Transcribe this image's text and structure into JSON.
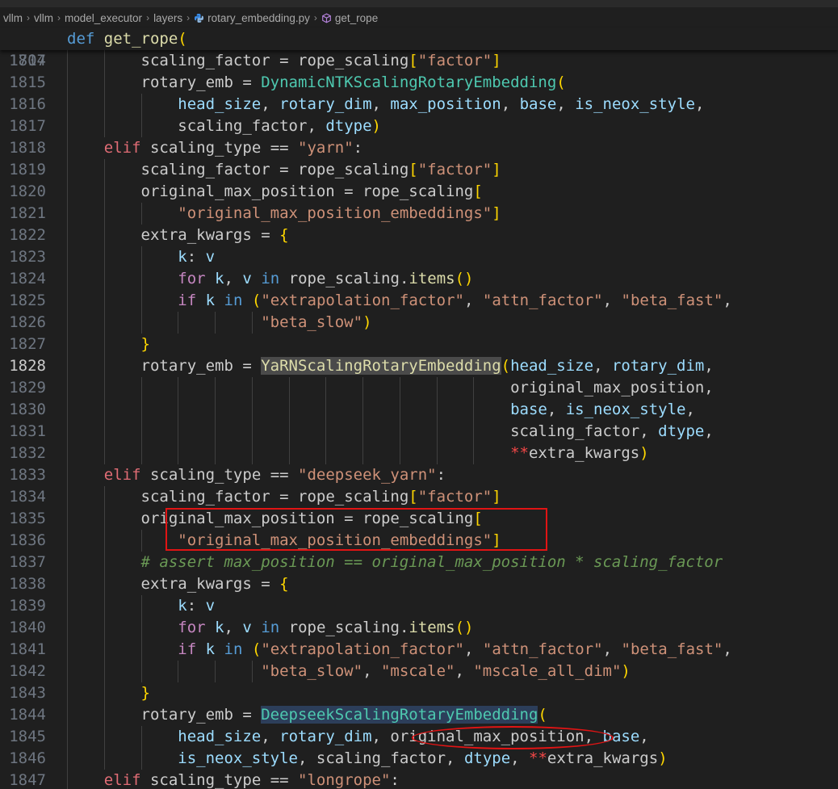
{
  "tab_strip": [
    "",
    ""
  ],
  "breadcrumb": {
    "items": [
      "vllm",
      "vllm",
      "model_executor",
      "layers",
      "rotary_embedding.py",
      "get_rope"
    ]
  },
  "colors": {
    "keyword": "#569cd6",
    "control": "#c586c0",
    "elif": "#e06c75",
    "function": "#dcdcaa",
    "class": "#4ec9b0",
    "string": "#ce9178",
    "variable": "#9cdcfe",
    "bracket1": "#ffd700",
    "bracket2": "#da70d6",
    "operator_red": "#f44747",
    "comment": "#6a9955",
    "annotation": "#e11414"
  },
  "sticky": {
    "num": "1707",
    "text": "def get_rope("
  },
  "active_line": "1828",
  "lines": [
    {
      "num": "1814",
      "text": "        scaling_factor = rope_scaling[\"factor\"]"
    },
    {
      "num": "1815",
      "text": "        rotary_emb = DynamicNTKScalingRotaryEmbedding("
    },
    {
      "num": "1816",
      "text": "            head_size, rotary_dim, max_position, base, is_neox_style,"
    },
    {
      "num": "1817",
      "text": "            scaling_factor, dtype)"
    },
    {
      "num": "1818",
      "text": "    elif scaling_type == \"yarn\":"
    },
    {
      "num": "1819",
      "text": "        scaling_factor = rope_scaling[\"factor\"]"
    },
    {
      "num": "1820",
      "text": "        original_max_position = rope_scaling["
    },
    {
      "num": "1821",
      "text": "            \"original_max_position_embeddings\"]"
    },
    {
      "num": "1822",
      "text": "        extra_kwargs = {"
    },
    {
      "num": "1823",
      "text": "            k: v"
    },
    {
      "num": "1824",
      "text": "            for k, v in rope_scaling.items()"
    },
    {
      "num": "1825",
      "text": "            if k in (\"extrapolation_factor\", \"attn_factor\", \"beta_fast\","
    },
    {
      "num": "1826",
      "text": "                     \"beta_slow\")"
    },
    {
      "num": "1827",
      "text": "        }"
    },
    {
      "num": "1828",
      "text": "        rotary_emb = YaRNScalingRotaryEmbedding(head_size, rotary_dim,"
    },
    {
      "num": "1829",
      "text": "                                                original_max_position,"
    },
    {
      "num": "1830",
      "text": "                                                base, is_neox_style,"
    },
    {
      "num": "1831",
      "text": "                                                scaling_factor, dtype,"
    },
    {
      "num": "1832",
      "text": "                                                **extra_kwargs)"
    },
    {
      "num": "1833",
      "text": "    elif scaling_type == \"deepseek_yarn\":"
    },
    {
      "num": "1834",
      "text": "        scaling_factor = rope_scaling[\"factor\"]"
    },
    {
      "num": "1835",
      "text": "        original_max_position = rope_scaling["
    },
    {
      "num": "1836",
      "text": "            \"original_max_position_embeddings\"]"
    },
    {
      "num": "1837",
      "text": "        # assert max_position == original_max_position * scaling_factor"
    },
    {
      "num": "1838",
      "text": "        extra_kwargs = {"
    },
    {
      "num": "1839",
      "text": "            k: v"
    },
    {
      "num": "1840",
      "text": "            for k, v in rope_scaling.items()"
    },
    {
      "num": "1841",
      "text": "            if k in (\"extrapolation_factor\", \"attn_factor\", \"beta_fast\","
    },
    {
      "num": "1842",
      "text": "                     \"beta_slow\", \"mscale\", \"mscale_all_dim\")"
    },
    {
      "num": "1843",
      "text": "        }"
    },
    {
      "num": "1844",
      "text": "        rotary_emb = DeepseekScalingRotaryEmbedding("
    },
    {
      "num": "1845",
      "text": "            head_size, rotary_dim, original_max_position, base,"
    },
    {
      "num": "1846",
      "text": "            is_neox_style, scaling_factor, dtype, **extra_kwargs)"
    },
    {
      "num": "1847",
      "text": "    elif scaling_type == \"longrope\":"
    }
  ]
}
